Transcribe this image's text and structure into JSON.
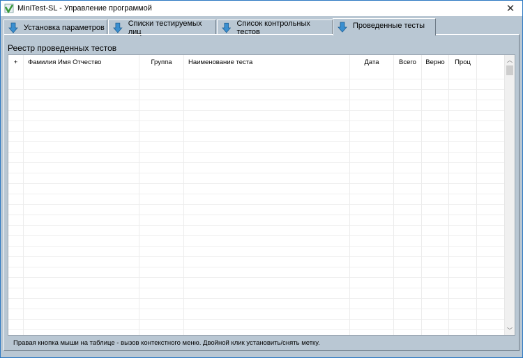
{
  "window": {
    "title": "MiniTest-SL - Управление программой"
  },
  "tabs": [
    {
      "label": "Установка параметров",
      "active": false
    },
    {
      "label": "Списки тестируемых лиц",
      "active": false
    },
    {
      "label": "Список контрольных тестов",
      "active": false
    },
    {
      "label": "Проведенные тесты",
      "active": true
    }
  ],
  "panel": {
    "caption": "Реестр проведенных тестов"
  },
  "table": {
    "columns": [
      "+",
      "Фамилия Имя Отчество",
      "Группа",
      "Наименование теста",
      "Дата",
      "Всего",
      "Верно",
      "Проц",
      ""
    ],
    "rows": []
  },
  "status": "Правая кнопка мыши на таблице - вызов контекстного меню.  Двойной клик установить/снять метку.",
  "colors": {
    "background": "#b9c7d3",
    "accent": "#2a8fd0"
  }
}
